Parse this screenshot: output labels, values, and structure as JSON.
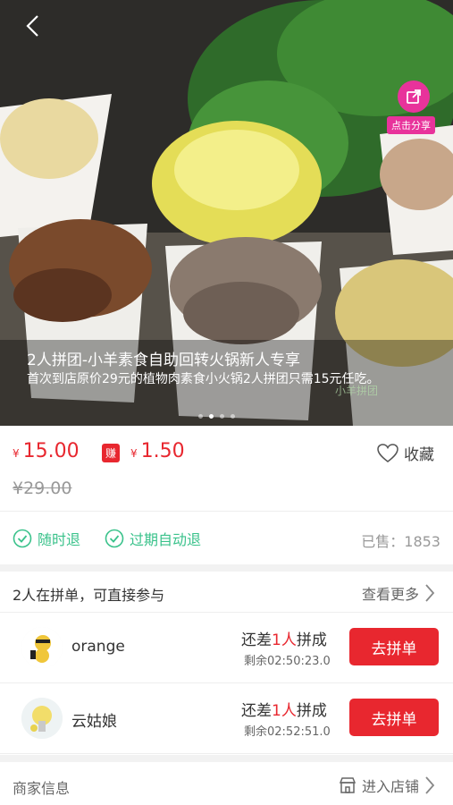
{
  "hero": {
    "title": "2人拼团-小羊素食自助回转火锅新人专享",
    "subtitle": "首次到店原价29元的植物肉素食小火锅2人拼团只需15元任吃。",
    "share_label": "点击分享",
    "watermark": "小羊拼团",
    "dots": 4,
    "active_dot": 1
  },
  "price": {
    "currency": "¥",
    "current": "15.00",
    "earn_badge": "赚",
    "earn": "1.50",
    "original": "¥29.00",
    "favorite_label": "收藏"
  },
  "guarantees": {
    "items": [
      "随时退",
      "过期自动退"
    ],
    "sold": "已售：1853"
  },
  "groups": {
    "title": "2人在拼单，可直接参与",
    "more": "查看更多",
    "rows": [
      {
        "name": "orange",
        "need_prefix": "还差",
        "need_count": "1人",
        "need_suffix": "拼成",
        "remaining": "剩余02:50:23.0",
        "button": "去拼单"
      },
      {
        "name": "云姑娘",
        "need_prefix": "还差",
        "need_count": "1人",
        "need_suffix": "拼成",
        "remaining": "剩余02:52:51.0",
        "button": "去拼单"
      }
    ]
  },
  "merchant": {
    "title": "商家信息",
    "enter": "进入店铺"
  },
  "colors": {
    "accent_red": "#e8272f",
    "green": "#3ac28b",
    "share_pink": "#e8339b"
  }
}
